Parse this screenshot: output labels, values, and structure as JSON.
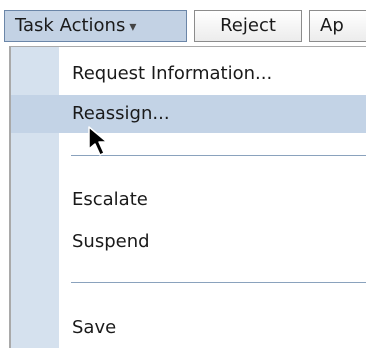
{
  "toolbar": {
    "task_actions_label": "Task Actions",
    "reject_label": "Reject",
    "approve_label_partial": "Ap"
  },
  "menu": {
    "items": [
      {
        "label": "Request Information..."
      },
      {
        "label": "Reassign..."
      },
      {
        "label": "Escalate"
      },
      {
        "label": "Suspend"
      },
      {
        "label": "Save"
      }
    ]
  },
  "colors": {
    "menu_gutter": "#d5e1ee",
    "hover_highlight": "#c3d3e6",
    "active_button": "#c3d2e4"
  },
  "icons": {
    "dropdown": "chevron-down-icon",
    "pointer": "mouse-cursor-icon"
  }
}
